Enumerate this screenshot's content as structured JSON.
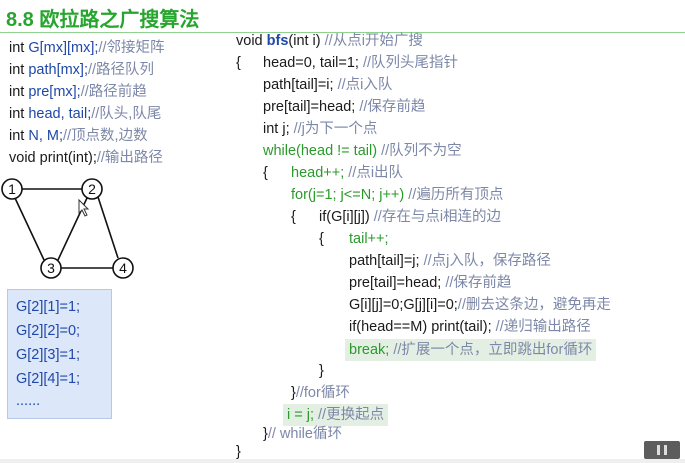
{
  "title": "8.8 欧拉路之广搜算法",
  "decl": [
    {
      "type": "int ",
      "name": "G[mx][mx];",
      "comment": "//邻接矩阵"
    },
    {
      "type": "int ",
      "name": "path[mx];",
      "comment": "//路径队列"
    },
    {
      "type": "int ",
      "name": "pre[mx];",
      "comment": "//路径前趋"
    },
    {
      "type": "int ",
      "name": "head, tail;",
      "comment": "//队头,队尾"
    },
    {
      "type": "int ",
      "name": "N, M;",
      "comment": "//顶点数,边数"
    },
    {
      "type": "void ",
      "name": "print(int);",
      "comment": "//输出路径"
    }
  ],
  "graph": {
    "nodes": [
      "1",
      "2",
      "3",
      "4"
    ]
  },
  "g_values": [
    "G[2][1]=1;",
    "G[2][2]=0;",
    "G[2][3]=1;",
    "G[2][4]=1;",
    "......"
  ],
  "code": {
    "l0": {
      "a": "void ",
      "fn": "bfs",
      "b": "(int i)",
      "c": "//从点i开始广搜"
    },
    "l1": {
      "a": "{",
      "b": "head=0, tail=1;",
      "c": "//队列头尾指针"
    },
    "l2": {
      "a": "path[tail]=i;",
      "c": "//点i入队"
    },
    "l3": {
      "a": "pre[tail]=head;",
      "c": "//保存前趋"
    },
    "l4": {
      "a": "int j;",
      "c": "//j为下一个点"
    },
    "l5": {
      "a": "while(head != tail)",
      "c": "//队列不为空"
    },
    "l6": {
      "a": "{",
      "b": "head++;",
      "c": "//点i出队"
    },
    "l7": {
      "a": "for(j=1; j<=N; j++)",
      "c": "//遍历所有顶点"
    },
    "l8": {
      "a": "{",
      "b": "if(G[i][j])",
      "c": "//存在与点i相连的边"
    },
    "l9": {
      "a": "{",
      "b": "tail++;"
    },
    "l10": {
      "a": "path[tail]=j;",
      "c": "//点j入队，保存路径"
    },
    "l11": {
      "a": "pre[tail]=head;",
      "c": "//保存前趋"
    },
    "l12": {
      "a": "G[i][j]=0;G[j][i]=0;",
      "c": "//删去这条边，避免再走"
    },
    "l13": {
      "a": "if(head==M) print(tail);",
      "c": "//递归输出路径"
    },
    "l14": {
      "a": "break;",
      "c": "//扩展一个点，立即跳出for循环"
    },
    "l15": {
      "a": "}"
    },
    "l16": {
      "a": "}",
      "c": "//for循环"
    },
    "l17": {
      "a": "i = j;",
      "c": "//更换起点"
    },
    "l18": {
      "a": "}",
      "c": "// while循环"
    },
    "l19": {
      "a": "}"
    }
  },
  "colors": {
    "title": "#27a52f",
    "variable": "#1f48a8",
    "keyword_green": "#2b9a2b",
    "comment": "#7d88a8",
    "highlight": "#e3efe3",
    "g_box": "#dce8fa"
  },
  "icons": {
    "pause": "pause-icon"
  }
}
